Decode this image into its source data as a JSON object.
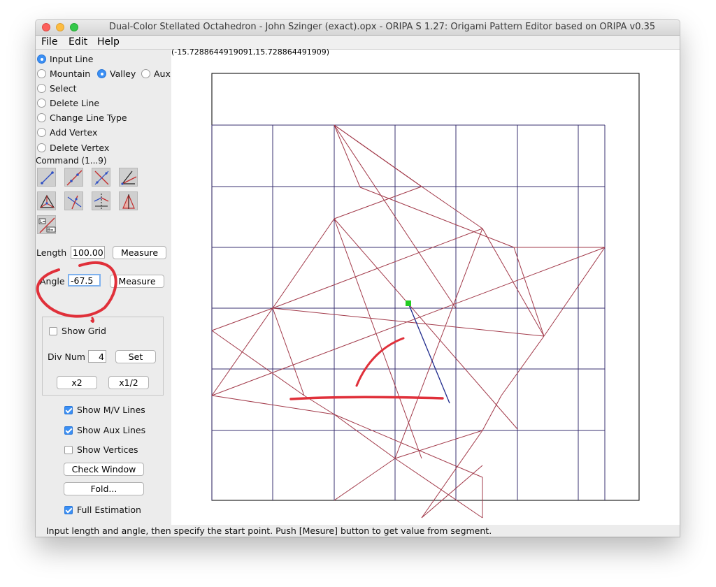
{
  "window": {
    "title": "Dual-Color Stellated Octahedron - John Szinger (exact).opx - ORIPA S 1.27: Origami Pattern Editor based on ORIPA  v0.35"
  },
  "menu": {
    "file": "File",
    "edit": "Edit",
    "help": "Help"
  },
  "modes": {
    "input_line": "Input Line",
    "mountain": "Mountain",
    "valley": "Valley",
    "aux": "Aux",
    "select": "Select",
    "delete_line": "Delete Line",
    "change_line_type": "Change Line Type",
    "add_vertex": "Add Vertex",
    "delete_vertex": "Delete Vertex",
    "selected_mode": "Input Line",
    "selected_line_type": "Valley"
  },
  "command_label": "Command (1...9)",
  "tools": [
    {
      "icon": "two-point-line-icon"
    },
    {
      "icon": "segment-line-icon"
    },
    {
      "icon": "perpendicular-bisector-icon"
    },
    {
      "icon": "angle-bisector-icon"
    },
    {
      "icon": "triangle-incenter-icon"
    },
    {
      "icon": "perpendicular-line-icon"
    },
    {
      "icon": "mirror-line-icon"
    },
    {
      "icon": "symmetric-line-icon"
    },
    {
      "icon": "length-angle-line-icon"
    }
  ],
  "length": {
    "label": "Length",
    "value": "100.000",
    "measure_label": "Measure"
  },
  "angle": {
    "label": "Angle",
    "value": "-67.5",
    "measure_label": "Measure"
  },
  "grid": {
    "show_grid_label": "Show Grid",
    "show_grid_checked": false,
    "div_num_label": "Div Num",
    "div_num_value": "4",
    "set_label": "Set",
    "x2_label": "x2",
    "half_label": "x1/2"
  },
  "view_options": {
    "show_mv_lines": "Show M/V Lines",
    "show_mv_checked": true,
    "show_aux_lines": "Show Aux Lines",
    "show_aux_checked": true,
    "show_vertices": "Show Vertices",
    "show_vertices_checked": false,
    "check_window": "Check Window",
    "fold": "Fold...",
    "full_estimation": "Full Estimation",
    "full_estimation_checked": true
  },
  "canvas": {
    "coordinates": "(-15.7288644919091,15.728864491909)"
  },
  "status": "Input length and angle, then specify the start point. Push [Mesure] button to get value from segment.",
  "colors": {
    "valley": "#a23a4a",
    "mountain": "#3a3070",
    "selection_point": "#22cc22",
    "annotation": "#e0303a",
    "accent": "#3b8ff4"
  }
}
